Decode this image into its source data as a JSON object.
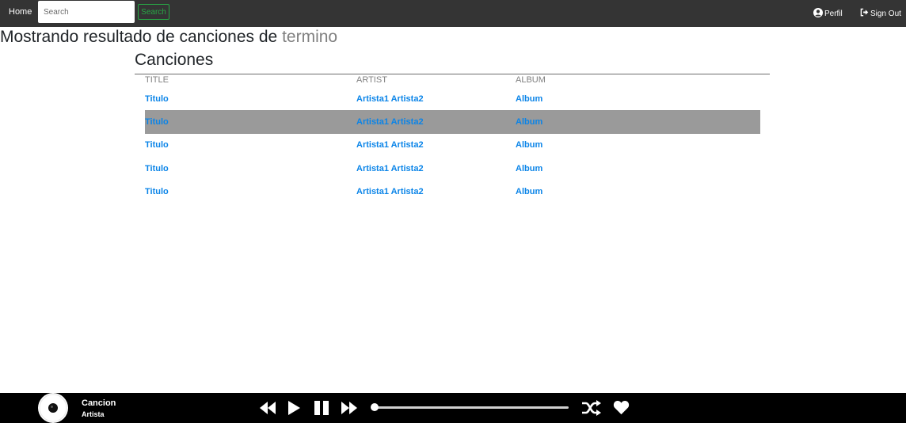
{
  "navbar": {
    "home_label": "Home",
    "search_placeholder": "Search",
    "search_button": "Search",
    "perfil_label": "Perfil",
    "signout_label": "Sign Out",
    "background": "#343434",
    "search_accent": "#28a745"
  },
  "results": {
    "heading_prefix": "Mostrando resultado de canciones de",
    "term": "termino"
  },
  "songs": {
    "section_title": "Canciones",
    "columns": {
      "title": "TITLE",
      "artist": "ARTIST",
      "album": "ALBUM"
    },
    "rows": [
      {
        "title": "Titulo",
        "artist": "Artista1 Artista2",
        "album": "Album",
        "selected": false
      },
      {
        "title": "Titulo",
        "artist": "Artista1 Artista2",
        "album": "Album",
        "selected": true
      },
      {
        "title": "Titulo",
        "artist": "Artista1 Artista2",
        "album": "Album",
        "selected": false
      },
      {
        "title": "Titulo",
        "artist": "Artista1 Artista2",
        "album": "Album",
        "selected": false
      },
      {
        "title": "Titulo",
        "artist": "Artista1 Artista2",
        "album": "Album",
        "selected": false
      }
    ],
    "link_color": "#0a84e8",
    "selected_row_color": "#9a9a9a"
  },
  "player": {
    "song_name": "Cancion",
    "artist_name": "Artista",
    "progress": 0,
    "icons": [
      "album-cover-icon",
      "rewind-icon",
      "play-icon",
      "pause-icon",
      "fast-forward-icon",
      "shuffle-icon",
      "heart-icon"
    ]
  }
}
